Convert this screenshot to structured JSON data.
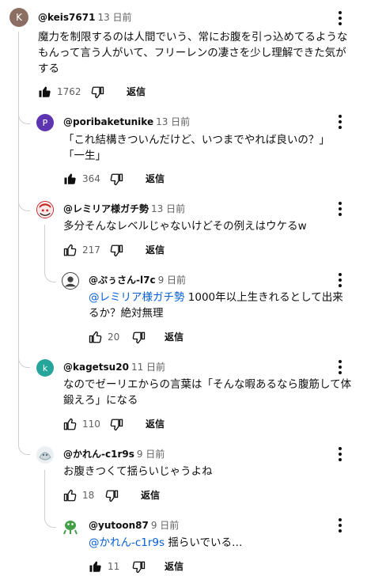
{
  "comments": [
    {
      "author": "@keis7671",
      "time": "13 日前",
      "text": "魔力を制限するのは人間でいう、常にお腹を引っ込めてるようなもんって言う人がいて、フリーレンの凄さを少し理解できた気がする",
      "likes": "1762",
      "reply_label": "返信",
      "avatar_letter": "K",
      "avatar_color": "#8d6e63"
    },
    {
      "author": "@poribaketunike",
      "time": "13 日前",
      "text": "「これ結構きついんだけど、いつまでやれば良いの？」\n「一生」",
      "likes": "364",
      "reply_label": "返信",
      "avatar_letter": "P",
      "avatar_color": "#5e35b1"
    },
    {
      "author": "@レミリア様ガチ勢",
      "time": "13 日前",
      "text": "多分そんなレベルじゃないけどその例えはウケるw",
      "likes": "217",
      "reply_label": "返信",
      "avatar_color": "#c62828"
    },
    {
      "author": "@ぷぅさん-l7c",
      "time": "9 日前",
      "mention": "@レミリア様ガチ勢",
      "text": " 1000年以上生きれるとして出来るか？絶対無理",
      "likes": "20",
      "reply_label": "返信",
      "avatar_color": "#424242"
    },
    {
      "author": "@kagetsu20",
      "time": "11 日前",
      "text": "なのでゼーリエからの言葉は「そんな暇あるなら腹筋して体鍛えろ」になる",
      "likes": "110",
      "reply_label": "返信",
      "avatar_letter": "k",
      "avatar_color": "#26a69a"
    },
    {
      "author": "@かれん-c1r9s",
      "time": "9 日前",
      "text": "お腹きつくて揺らいじゃうよね",
      "likes": "18",
      "reply_label": "返信",
      "avatar_color": "#b0bec5"
    },
    {
      "author": "@yutoon87",
      "time": "9 日前",
      "mention": "@かれん-c1r9s",
      "text": " 揺らいでいる…",
      "likes": "11",
      "reply_label": "返信",
      "avatar_color": "#43a047"
    }
  ],
  "icons": {
    "like": "thumbs-up-icon",
    "dislike": "thumbs-down-icon",
    "more": "more-vertical-icon"
  },
  "colors": {
    "mention": "#065fd4",
    "meta": "#606060",
    "thread_line": "#cfcfcf"
  }
}
